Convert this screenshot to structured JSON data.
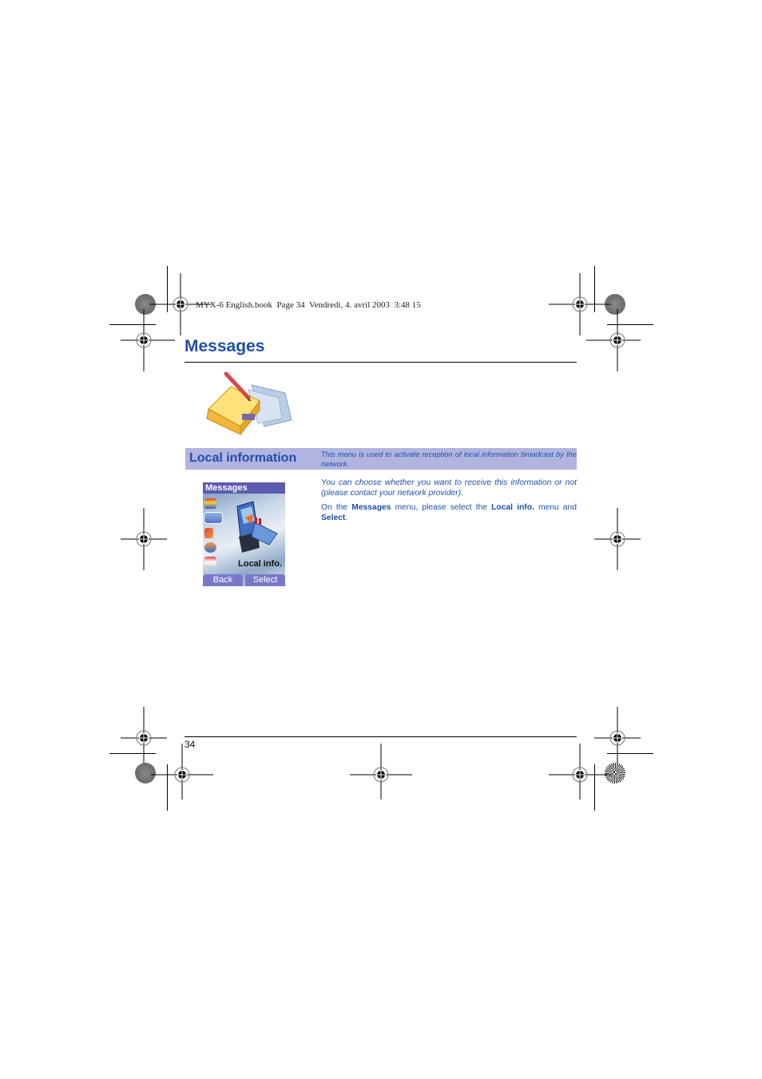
{
  "print_header": "MYX-6 English.book  Page 34  Vendredi, 4. avril 2003  3:48 15",
  "page": {
    "title": "Messages",
    "section": {
      "title": "Local information",
      "description": "This menu is used to activate reception of local information broadcast by the network."
    },
    "paragraphs": {
      "p1": "You can choose whether you want to receive this information or not (please contact your network provider).",
      "p2_prefix": "On the ",
      "p2_bold1": "Messages",
      "p2_mid": " menu, please select the ",
      "p2_bold2": "Local info.",
      "p2_mid2": " menu and ",
      "p2_bold3": "Select",
      "p2_suffix": "."
    },
    "page_number": "34"
  },
  "phone_screen": {
    "title": "Messages",
    "selected_label": "Local info.",
    "softkeys": {
      "left": "Back",
      "right": "Select"
    },
    "menu_icons": [
      "inbox-icon",
      "compose-icon",
      "pen-icon",
      "cell-broadcast-icon",
      "outbox-icon"
    ]
  },
  "colors": {
    "accent_blue": "#1f4ea8",
    "band_bg": "#b2b4e0",
    "phone_titlebar": "#5d5bb0",
    "softkey_bg": "#7a78c8"
  }
}
